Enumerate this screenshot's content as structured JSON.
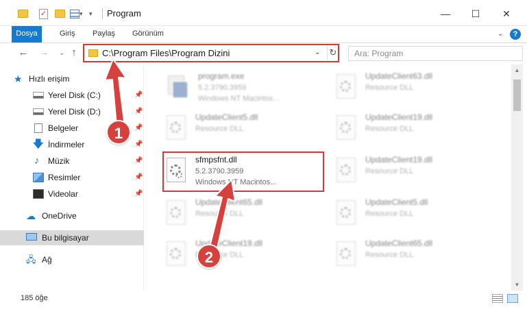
{
  "window": {
    "title": "Program",
    "minimize": "—",
    "maximize": "☐",
    "close": "✕"
  },
  "ribbon": {
    "tabs": [
      "Dosya",
      "Giriş",
      "Paylaş",
      "Görünüm"
    ],
    "help": "?"
  },
  "address": {
    "path": "C:\\Program Files\\Program Dizini",
    "search_placeholder": "Ara: Program"
  },
  "nav": {
    "items": [
      {
        "label": "Hızlı erişim",
        "icon": "star-icon",
        "pinned": false
      },
      {
        "label": "Yerel Disk (C:)",
        "icon": "disk-icon",
        "pinned": true
      },
      {
        "label": "Yerel Disk (D:)",
        "icon": "disk-icon",
        "pinned": true
      },
      {
        "label": "Belgeler",
        "icon": "documents-icon",
        "pinned": true
      },
      {
        "label": "İndirmeler",
        "icon": "download-icon",
        "pinned": true
      },
      {
        "label": "Müzik",
        "icon": "music-icon",
        "pinned": true
      },
      {
        "label": "Resimler",
        "icon": "pictures-icon",
        "pinned": true
      },
      {
        "label": "Videolar",
        "icon": "videos-icon",
        "pinned": true
      },
      {
        "label": "OneDrive",
        "icon": "cloud-icon",
        "pinned": false
      },
      {
        "label": "Bu bilgisayar",
        "icon": "computer-icon",
        "pinned": false,
        "selected": true
      },
      {
        "label": "Ağ",
        "icon": "network-icon",
        "pinned": false
      }
    ]
  },
  "files": [
    {
      "name": "program.exe",
      "line1": "5.2.3790.3959",
      "line2": "Windows NT Macintos...",
      "type": "exe",
      "blurred": true
    },
    {
      "name": "UpdateClient63.dll",
      "line1": "Resource DLL",
      "line2": "",
      "type": "dll",
      "blurred": true
    },
    {
      "name": "UpdateClient5.dll",
      "line1": "Resource DLL",
      "line2": "",
      "type": "dll",
      "blurred": true
    },
    {
      "name": "UpdateClient19.dll",
      "line1": "Resource DLL",
      "line2": "",
      "type": "dll",
      "blurred": true
    },
    {
      "name": "sfmpsfnt.dll",
      "line1": "5.2.3790.3959",
      "line2": "Windows NT Macintos...",
      "type": "dll",
      "blurred": false
    },
    {
      "name": "UpdateClient19.dll",
      "line1": "Resource DLL",
      "line2": "",
      "type": "dll",
      "blurred": true
    },
    {
      "name": "UpdateClient65.dll",
      "line1": "Resource DLL",
      "line2": "",
      "type": "dll",
      "blurred": true
    },
    {
      "name": "UpdateClient5.dll",
      "line1": "Resource DLL",
      "line2": "",
      "type": "dll",
      "blurred": true
    },
    {
      "name": "UpdateClient19.dll",
      "line1": "Resource DLL",
      "line2": "",
      "type": "dll",
      "blurred": true
    },
    {
      "name": "UpdateClient65.dll",
      "line1": "Resource DLL",
      "line2": "",
      "type": "dll",
      "blurred": true
    }
  ],
  "status": {
    "item_count": "185 öğe"
  },
  "annotations": {
    "step1": "1",
    "step2": "2",
    "color": "#d7413d"
  }
}
